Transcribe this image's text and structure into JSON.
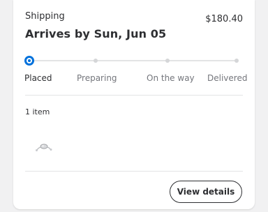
{
  "shipment": {
    "label": "Shipping",
    "price": "$180.40",
    "arrival": "Arrives by Sun, Jun 05"
  },
  "progress": {
    "current_step": 0,
    "steps": [
      {
        "label": "Placed",
        "active": true
      },
      {
        "label": "Preparing",
        "active": false
      },
      {
        "label": "On the way",
        "active": false
      },
      {
        "label": "Delivered",
        "active": false
      }
    ]
  },
  "items": {
    "count_label": "1 item",
    "thumbnail_icon": "earbuds-product-icon"
  },
  "actions": {
    "view_details_label": "View details"
  },
  "colors": {
    "accent": "#0071dc",
    "text": "#2e2f32",
    "muted": "#74767c"
  }
}
